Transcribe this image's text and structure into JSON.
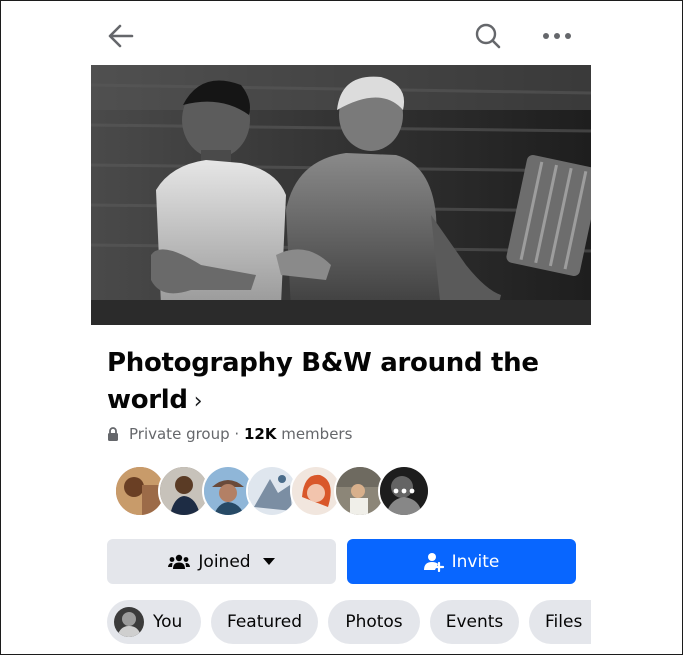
{
  "header": {
    "back_icon": "arrow-left-icon",
    "search_icon": "search-icon",
    "more_icon": "more-horizontal-icon"
  },
  "group": {
    "name_line1": "Photography B&W around the",
    "name_line2": "world",
    "privacy": "Private group",
    "separator": " · ",
    "member_count": "12K",
    "members_label": " members"
  },
  "actions": {
    "joined_label": "Joined",
    "invite_label": "Invite"
  },
  "tabs": [
    {
      "label": "You"
    },
    {
      "label": "Featured"
    },
    {
      "label": "Photos"
    },
    {
      "label": "Events"
    },
    {
      "label": "Files"
    }
  ],
  "colors": {
    "accent": "#0866ff",
    "button_gray": "#e4e6eb",
    "secondary_text": "#65676b"
  }
}
